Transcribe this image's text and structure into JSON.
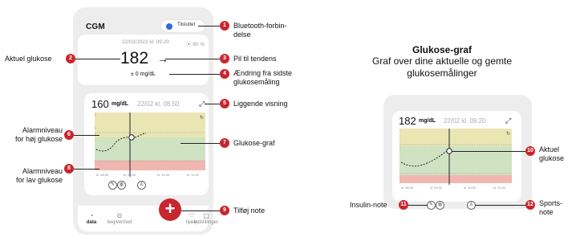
{
  "app": {
    "title": "CGM"
  },
  "bluetooth": {
    "status": "Tilsluttet"
  },
  "current": {
    "date": "22/02/2023 kl. 09.20",
    "sensor": "⦿ 80 %",
    "value": "182",
    "arrow": "→",
    "delta": "± 0 mg/dL"
  },
  "graph_card": {
    "value": "160",
    "unit": "mg/dL",
    "date": "22/02 kl. 08.50",
    "y_ticks": [
      "250",
      "180",
      "144",
      "54",
      "0"
    ],
    "x_ticks": [
      "kl. 08.00",
      "kl. 09.00",
      "kl. 10.00",
      "kl. 11.00"
    ]
  },
  "nav": {
    "items": [
      {
        "label": "data",
        "icon": "data-icon"
      },
      {
        "label": "begivenhed",
        "icon": "event-icon"
      },
      {
        "label": "hjælp",
        "icon": "help-icon"
      },
      {
        "label": "indstillinger",
        "icon": "settings-icon"
      }
    ],
    "add": "+"
  },
  "annotations": {
    "a1": {
      "num": "1",
      "text": [
        "Bluetooth-forbin-",
        "delse"
      ]
    },
    "a2": {
      "num": "2",
      "text": [
        "Aktuel glukose"
      ]
    },
    "a3": {
      "num": "3",
      "text": [
        "Pil til tendens"
      ]
    },
    "a4": {
      "num": "4",
      "text": [
        "Ændring fra sidste",
        "glukosemåling"
      ]
    },
    "a5": {
      "num": "5",
      "text": [
        "Liggende visning"
      ]
    },
    "a6": {
      "num": "6",
      "text": [
        "Alarmniveau",
        "for høj glukose"
      ]
    },
    "a7": {
      "num": "7",
      "text": [
        "Glukose-graf"
      ]
    },
    "a8": {
      "num": "8",
      "text": [
        "Alarmniveau",
        "for lav glukose"
      ]
    },
    "a9": {
      "num": "9",
      "text": [
        "Tilføj note"
      ]
    },
    "a10": {
      "num": "10",
      "text": [
        "Aktuel",
        "glukose"
      ]
    },
    "a11": {
      "num": "11",
      "text": [
        "Insulin-note"
      ]
    },
    "a12": {
      "num": "12",
      "text": [
        "Sports-",
        "note"
      ]
    }
  },
  "right_panel": {
    "title": "Glukose-graf",
    "subtitle": "Graf over dine aktuelle og gemte glukosemålinger",
    "value": "182",
    "unit": "mg/dL",
    "date": "22/02 kl. 09.20",
    "y_ticks": [
      "250",
      "180",
      "144",
      "54",
      "0"
    ],
    "x_ticks": [
      "kl. 08.00",
      "kl. 09.00",
      "kl. 10.00",
      "kl. 11.00"
    ]
  },
  "colors": {
    "accent": "#c8262e",
    "high_zone": "#e9e6b4",
    "target_zone": "#cfe3c2",
    "low_zone": "#f1b6b0"
  }
}
